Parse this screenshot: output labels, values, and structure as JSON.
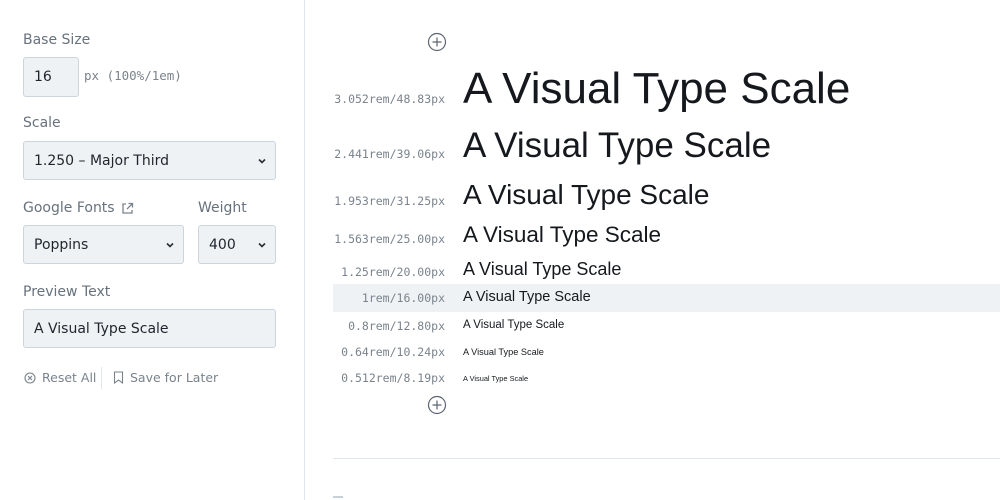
{
  "sidebar": {
    "base_size": {
      "label": "Base Size",
      "value": "16",
      "hint": "px (100%/1em)"
    },
    "scale": {
      "label": "Scale",
      "selected": "1.250 – Major Third"
    },
    "fonts": {
      "label": "Google Fonts",
      "selected": "Poppins"
    },
    "weight": {
      "label": "Weight",
      "selected": "400"
    },
    "preview": {
      "label": "Preview Text",
      "value": "A Visual Type Scale"
    },
    "actions": {
      "reset": "Reset All",
      "save": "Save for Later"
    }
  },
  "scale_rows": [
    {
      "size": "3.052rem/48.83px",
      "text": "A Visual Type Scale"
    },
    {
      "size": "2.441rem/39.06px",
      "text": "A Visual Type Scale"
    },
    {
      "size": "1.953rem/31.25px",
      "text": "A Visual Type Scale"
    },
    {
      "size": "1.563rem/25.00px",
      "text": "A Visual Type Scale"
    },
    {
      "size": "1.25rem/20.00px",
      "text": "A Visual Type Scale"
    },
    {
      "size": "1rem/16.00px",
      "text": "A Visual Type Scale"
    },
    {
      "size": "0.8rem/12.80px",
      "text": "A Visual Type Scale"
    },
    {
      "size": "0.64rem/10.24px",
      "text": "A Visual Type Scale"
    },
    {
      "size": "0.512rem/8.19px",
      "text": "A Visual Type Scale"
    }
  ],
  "icons": {
    "add_larger": "plus-circle-icon",
    "add_smaller": "plus-circle-icon",
    "external": "external-link-icon",
    "reset": "x-circle-icon",
    "save": "bookmark-icon",
    "chevron": "chevron-down-icon"
  },
  "colors": {
    "accent_bg": "#eef2f5",
    "border": "#cdd5dc",
    "muted": "#7a838c"
  }
}
